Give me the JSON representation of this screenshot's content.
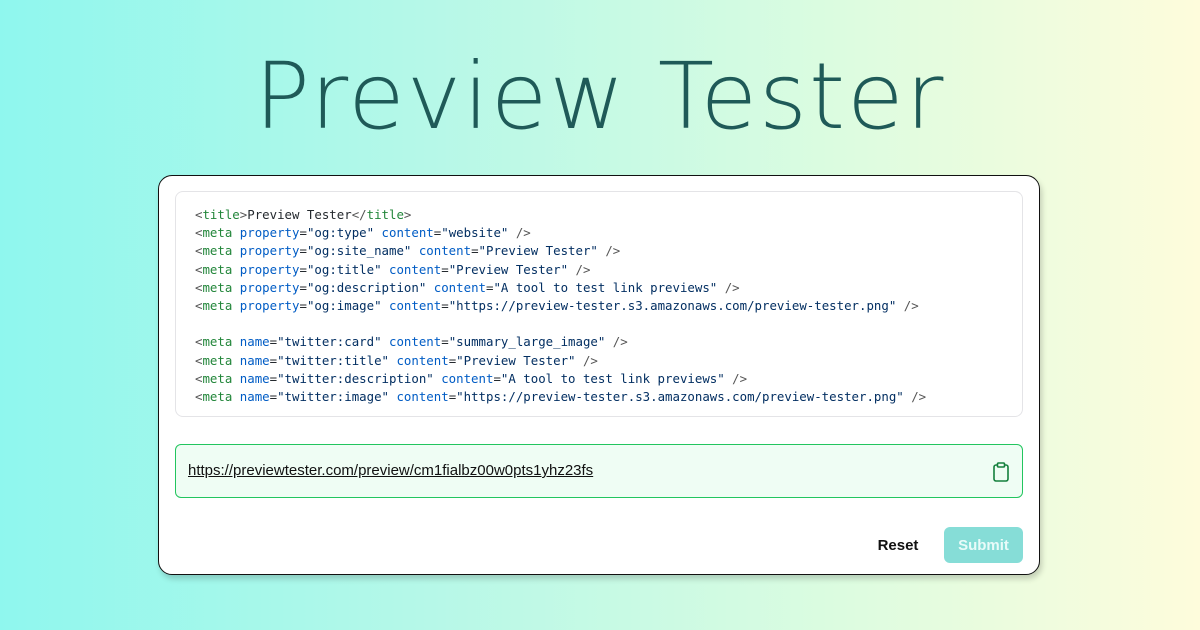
{
  "page": {
    "title": "Preview Tester"
  },
  "code": {
    "lines": [
      [
        [
          "punct",
          "<"
        ],
        [
          "tag",
          "title"
        ],
        [
          "punct",
          ">"
        ],
        [
          "text",
          "Preview Tester"
        ],
        [
          "punct",
          "</"
        ],
        [
          "tag",
          "title"
        ],
        [
          "punct",
          ">"
        ]
      ],
      [
        [
          "punct",
          "<"
        ],
        [
          "tag",
          "meta"
        ],
        [
          "text",
          " "
        ],
        [
          "attr",
          "property"
        ],
        [
          "eq",
          "="
        ],
        [
          "str",
          "\"og:type\""
        ],
        [
          "text",
          " "
        ],
        [
          "attr",
          "content"
        ],
        [
          "eq",
          "="
        ],
        [
          "str",
          "\"website\""
        ],
        [
          "punct",
          " />"
        ]
      ],
      [
        [
          "punct",
          "<"
        ],
        [
          "tag",
          "meta"
        ],
        [
          "text",
          " "
        ],
        [
          "attr",
          "property"
        ],
        [
          "eq",
          "="
        ],
        [
          "str",
          "\"og:site_name\""
        ],
        [
          "text",
          " "
        ],
        [
          "attr",
          "content"
        ],
        [
          "eq",
          "="
        ],
        [
          "str",
          "\"Preview Tester\""
        ],
        [
          "punct",
          " />"
        ]
      ],
      [
        [
          "punct",
          "<"
        ],
        [
          "tag",
          "meta"
        ],
        [
          "text",
          " "
        ],
        [
          "attr",
          "property"
        ],
        [
          "eq",
          "="
        ],
        [
          "str",
          "\"og:title\""
        ],
        [
          "text",
          " "
        ],
        [
          "attr",
          "content"
        ],
        [
          "eq",
          "="
        ],
        [
          "str",
          "\"Preview Tester\""
        ],
        [
          "punct",
          " />"
        ]
      ],
      [
        [
          "punct",
          "<"
        ],
        [
          "tag",
          "meta"
        ],
        [
          "text",
          " "
        ],
        [
          "attr",
          "property"
        ],
        [
          "eq",
          "="
        ],
        [
          "str",
          "\"og:description\""
        ],
        [
          "text",
          " "
        ],
        [
          "attr",
          "content"
        ],
        [
          "eq",
          "="
        ],
        [
          "str",
          "\"A tool to test link previews\""
        ],
        [
          "punct",
          " />"
        ]
      ],
      [
        [
          "punct",
          "<"
        ],
        [
          "tag",
          "meta"
        ],
        [
          "text",
          " "
        ],
        [
          "attr",
          "property"
        ],
        [
          "eq",
          "="
        ],
        [
          "str",
          "\"og:image\""
        ],
        [
          "text",
          " "
        ],
        [
          "attr",
          "content"
        ],
        [
          "eq",
          "="
        ],
        [
          "str",
          "\"https://preview-tester.s3.amazonaws.com/preview-tester.png\""
        ],
        [
          "punct",
          " />"
        ]
      ],
      [],
      [
        [
          "punct",
          "<"
        ],
        [
          "tag",
          "meta"
        ],
        [
          "text",
          " "
        ],
        [
          "attr",
          "name"
        ],
        [
          "eq",
          "="
        ],
        [
          "str",
          "\"twitter:card\""
        ],
        [
          "text",
          " "
        ],
        [
          "attr",
          "content"
        ],
        [
          "eq",
          "="
        ],
        [
          "str",
          "\"summary_large_image\""
        ],
        [
          "punct",
          " />"
        ]
      ],
      [
        [
          "punct",
          "<"
        ],
        [
          "tag",
          "meta"
        ],
        [
          "text",
          " "
        ],
        [
          "attr",
          "name"
        ],
        [
          "eq",
          "="
        ],
        [
          "str",
          "\"twitter:title\""
        ],
        [
          "text",
          " "
        ],
        [
          "attr",
          "content"
        ],
        [
          "eq",
          "="
        ],
        [
          "str",
          "\"Preview Tester\""
        ],
        [
          "punct",
          " />"
        ]
      ],
      [
        [
          "punct",
          "<"
        ],
        [
          "tag",
          "meta"
        ],
        [
          "text",
          " "
        ],
        [
          "attr",
          "name"
        ],
        [
          "eq",
          "="
        ],
        [
          "str",
          "\"twitter:description\""
        ],
        [
          "text",
          " "
        ],
        [
          "attr",
          "content"
        ],
        [
          "eq",
          "="
        ],
        [
          "str",
          "\"A tool to test link previews\""
        ],
        [
          "punct",
          " />"
        ]
      ],
      [
        [
          "punct",
          "<"
        ],
        [
          "tag",
          "meta"
        ],
        [
          "text",
          " "
        ],
        [
          "attr",
          "name"
        ],
        [
          "eq",
          "="
        ],
        [
          "str",
          "\"twitter:image\""
        ],
        [
          "text",
          " "
        ],
        [
          "attr",
          "content"
        ],
        [
          "eq",
          "="
        ],
        [
          "str",
          "\"https://preview-tester.s3.amazonaws.com/preview-tester.png\""
        ],
        [
          "punct",
          " />"
        ]
      ]
    ]
  },
  "url_field": {
    "value": "https://previewtester.com/preview/cm1fialbz00w0pts1yhz23fs",
    "copy_icon": "clipboard-icon",
    "accent_color": "#22c55e"
  },
  "actions": {
    "reset_label": "Reset",
    "submit_label": "Submit",
    "submit_color": "#86ddd7"
  }
}
